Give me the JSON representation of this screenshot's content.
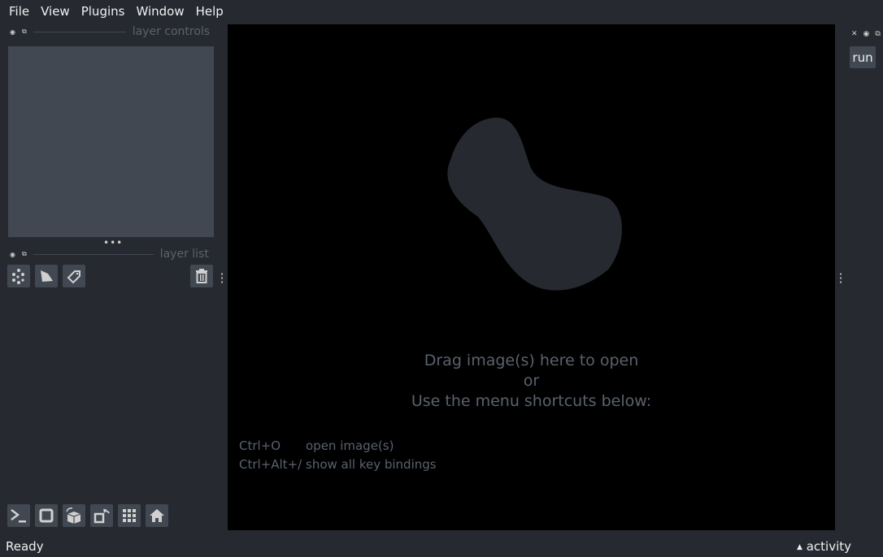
{
  "menu": [
    "File",
    "View",
    "Plugins",
    "Window",
    "Help"
  ],
  "left_dock": {
    "controls_title": "layer controls",
    "list_title": "layer list"
  },
  "layer_buttons": [
    "new-points",
    "new-shapes",
    "new-labels",
    "delete-layer"
  ],
  "welcome": {
    "line1": "Drag image(s) here to open",
    "line2": "or",
    "line3": "Use the menu shortcuts below:",
    "shortcuts": [
      {
        "keys": "Ctrl+O",
        "desc": "open image(s)"
      },
      {
        "keys": "Ctrl+Alt+/",
        "desc": "show all key bindings"
      }
    ]
  },
  "right_dock": {
    "run_label": "run"
  },
  "status": {
    "text": "Ready",
    "activity": "activity"
  },
  "colors": {
    "background": "#262930",
    "panel": "#414851",
    "canvas": "#000000",
    "muted_text": "#5a626c"
  }
}
